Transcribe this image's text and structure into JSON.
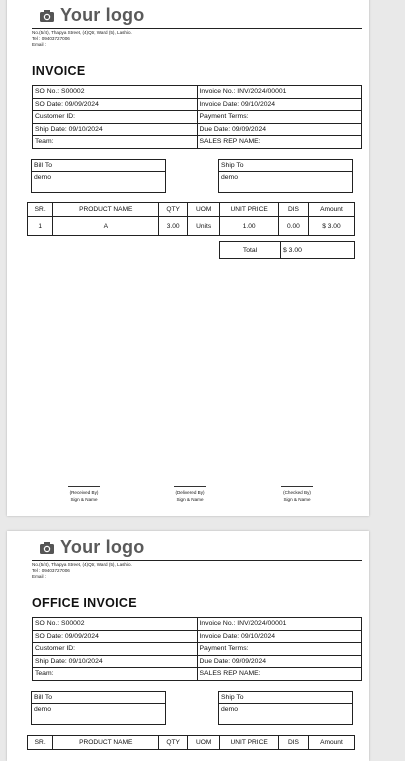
{
  "logo": {
    "text": "Your logo",
    "icon": "camera-icon"
  },
  "company": {
    "address": "No.(5/4), Thapya Street, (4)Qtr, Ward (5), Lashio.",
    "tel": "Tel : 09403727006",
    "email": "Email :"
  },
  "page1": {
    "title": "INVOICE",
    "meta": {
      "so_no": "SO No.: S00002",
      "invoice_no": "Invoice No.: INV/2024/00001",
      "so_date": "SO Date: 09/09/2024",
      "invoice_date": "Invoice Date: 09/10/2024",
      "customer_id": "Customer ID:",
      "payment_terms": "Payment Terms:",
      "ship_date": "Ship Date: 09/10/2024",
      "due_date": "Due Date: 09/09/2024",
      "team": "Team:",
      "sales_rep": "SALES REP NAME:"
    },
    "bill_to": {
      "label": "Bill To",
      "value": "demo"
    },
    "ship_to": {
      "label": "Ship To",
      "value": "demo"
    },
    "columns": [
      "SR.",
      "PRODUCT NAME",
      "QTY",
      "UOM",
      "UNIT PRICE",
      "DIS",
      "Amount"
    ],
    "rows": [
      {
        "sr": "1",
        "product": "A",
        "qty": "3.00",
        "uom": "Units",
        "unit_price": "1.00",
        "dis": "0.00",
        "amount": "$ 3.00"
      }
    ],
    "total_label": "Total",
    "total_value": "$ 3.00",
    "signatures": [
      {
        "role": "(Received By)",
        "sign": "Sign & Name"
      },
      {
        "role": "(Delivered By)",
        "sign": "Sign & Name"
      },
      {
        "role": "(Checked By)",
        "sign": "Sign & Name"
      }
    ]
  },
  "page2": {
    "title": "OFFICE INVOICE",
    "meta": {
      "so_no": "SO No.: S00002",
      "invoice_no": "Invoice No.: INV/2024/00001",
      "so_date": "SO Date: 09/09/2024",
      "invoice_date": "Invoice Date: 09/10/2024",
      "customer_id": "Customer ID:",
      "payment_terms": "Payment Terms:",
      "ship_date": "Ship Date: 09/10/2024",
      "due_date": "Due Date: 09/09/2024",
      "team": "Team:",
      "sales_rep": "SALES REP NAME:"
    },
    "bill_to": {
      "label": "Bill To",
      "value": "demo"
    },
    "ship_to": {
      "label": "Ship To",
      "value": "demo"
    },
    "columns": [
      "SR.",
      "PRODUCT NAME",
      "QTY",
      "UOM",
      "UNIT PRICE",
      "DIS",
      "Amount"
    ]
  }
}
